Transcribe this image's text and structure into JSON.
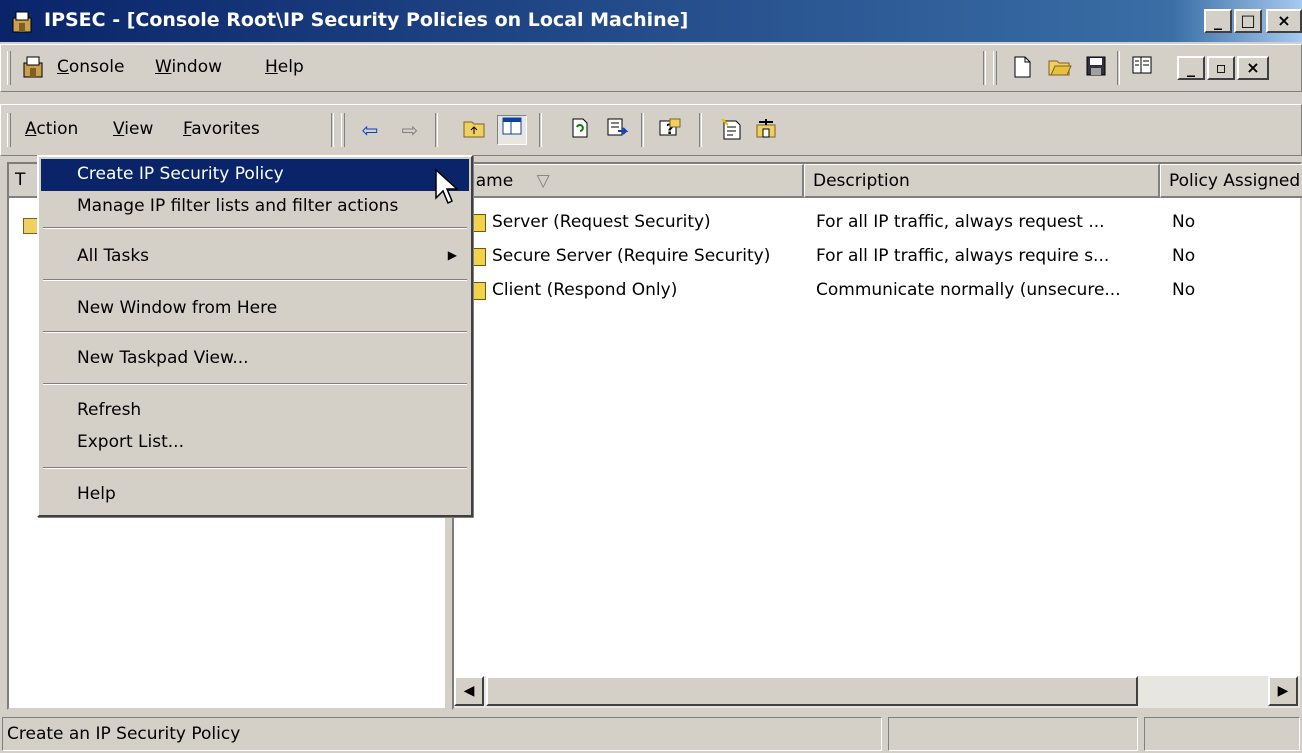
{
  "window": {
    "title": "IPSEC - [Console Root\\IP Security Policies on Local Machine]",
    "min": "_",
    "max": "□",
    "close": "×"
  },
  "menubar": {
    "console": "Console",
    "window": "Window",
    "help": "Help",
    "child_min": "_",
    "child_restore": "▫",
    "child_close": "×"
  },
  "actionbar": {
    "action": "Action",
    "view": "View",
    "favorites": "Favorites"
  },
  "left_pane": {
    "header_initial": "T"
  },
  "list": {
    "columns": [
      "Name",
      "Description",
      "Policy Assigned"
    ],
    "sort_arrow": "▽",
    "rows": [
      {
        "name": "Server (Request Security)",
        "description": "For all IP traffic, always request ...",
        "assigned": "No"
      },
      {
        "name": "Secure Server (Require Security)",
        "description": "For all IP traffic, always require s...",
        "assigned": "No"
      },
      {
        "name": "Client (Respond Only)",
        "description": "Communicate normally (unsecure...",
        "assigned": "No"
      }
    ]
  },
  "context_menu": {
    "create_policy": "Create IP Security Policy",
    "manage_filters": "Manage IP filter lists and filter actions",
    "all_tasks": "All Tasks",
    "new_window": "New Window from Here",
    "new_taskpad": "New Taskpad View...",
    "refresh": "Refresh",
    "export_list": "Export List...",
    "help": "Help"
  },
  "statusbar": {
    "text": "Create an IP Security Policy"
  },
  "colors": {
    "titlebar_start": "#0a246a",
    "titlebar_end": "#a6caf0",
    "highlight": "#0a246a",
    "face": "#d4d0c8"
  }
}
